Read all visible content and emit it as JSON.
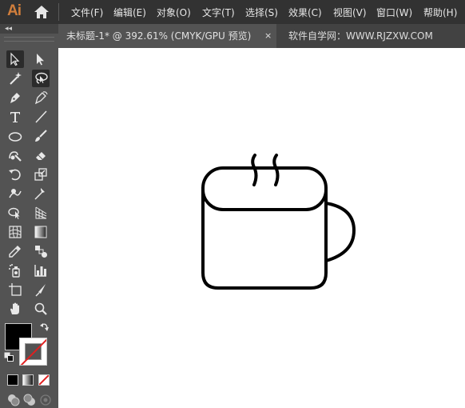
{
  "app": {
    "logo_text": "Ai"
  },
  "menu": {
    "items": [
      {
        "label": "文件(F)"
      },
      {
        "label": "编辑(E)"
      },
      {
        "label": "对象(O)"
      },
      {
        "label": "文字(T)"
      },
      {
        "label": "选择(S)"
      },
      {
        "label": "效果(C)"
      },
      {
        "label": "视图(V)"
      },
      {
        "label": "窗口(W)"
      },
      {
        "label": "帮助(H)"
      }
    ]
  },
  "panel": {
    "collapse_glyph": "◂◂"
  },
  "tabs": {
    "active_title": "未标题-1* @ 392.61% (CMYK/GPU 预览)",
    "close_glyph": "×",
    "inactive_title": "软件自学网：WWW.RJZXW.COM"
  },
  "tools": [
    "selection-tool",
    "direct-selection-tool",
    "magic-wand-tool",
    "lasso-tool",
    "pen-tool",
    "curvature-tool",
    "type-tool",
    "line-segment-tool",
    "ellipse-tool",
    "paintbrush-tool",
    "shaper-tool",
    "eraser-tool",
    "rotate-tool",
    "scale-tool",
    "warp-tool",
    "puppet-warp-tool",
    "shape-builder-tool",
    "perspective-grid-tool",
    "mesh-tool",
    "gradient-tool",
    "eyedropper-tool",
    "blend-tool",
    "symbol-sprayer-tool",
    "column-graph-tool",
    "artboard-tool",
    "slice-tool",
    "hand-tool",
    "zoom-tool"
  ],
  "colors": {
    "menubar": "#323232",
    "panel": "#535353",
    "tabbar": "#424242",
    "logo": "#d07e3c",
    "canvas": "#ffffff",
    "fill": "#000000",
    "stroke": "#ffffff",
    "none_slash": "#e02020"
  }
}
